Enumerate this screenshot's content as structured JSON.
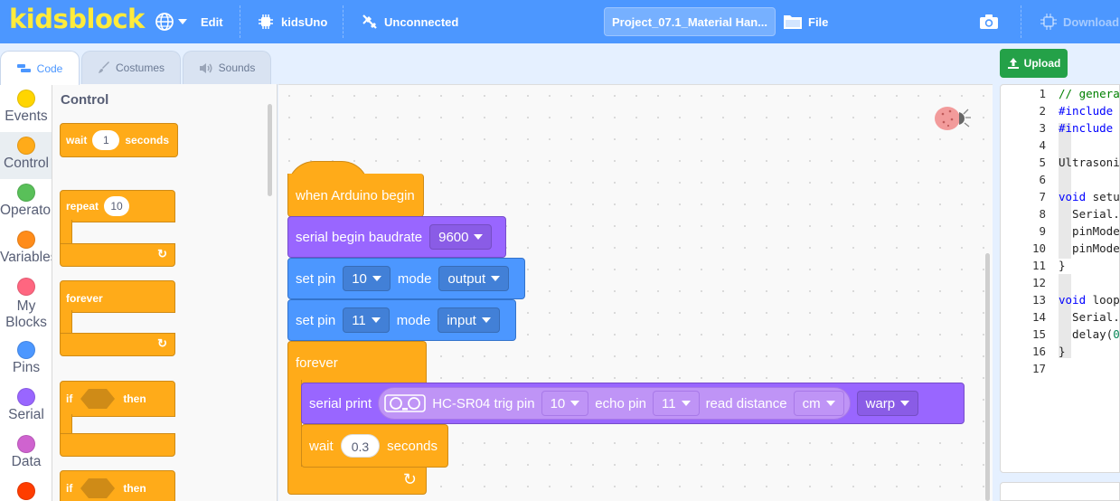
{
  "menubar": {
    "logo": "kidsblock",
    "edit": "Edit",
    "board": "kidsUno",
    "connection": "Unconnected",
    "project_name": "Project_07.1_Material Han...",
    "file": "File",
    "download": "Download"
  },
  "tabs": {
    "code": "Code",
    "costumes": "Costumes",
    "sounds": "Sounds"
  },
  "upload_label": "Upload",
  "categories": [
    {
      "label": "Events",
      "color": "#ffd500"
    },
    {
      "label": "Control",
      "color": "#ffab19"
    },
    {
      "label": "Operators",
      "color": "#59c059"
    },
    {
      "label": "Variables",
      "color": "#ff8c1a"
    },
    {
      "label": "My Blocks",
      "color": "#ff6680"
    },
    {
      "label": "Pins",
      "color": "#4c97ff"
    },
    {
      "label": "Serial",
      "color": "#9966ff"
    },
    {
      "label": "Data",
      "color": "#cf63cf"
    },
    {
      "label": "",
      "color": "#ff3d00"
    }
  ],
  "flyout": {
    "title": "Control",
    "wait": {
      "label": "wait",
      "value": "1",
      "unit": "seconds"
    },
    "repeat": {
      "label": "repeat",
      "value": "10"
    },
    "forever": "forever",
    "if1": {
      "label": "if",
      "then": "then"
    },
    "if2": {
      "label": "if",
      "then": "then"
    }
  },
  "script": {
    "hat": "when Arduino begin",
    "baud": {
      "label": "serial begin baudrate",
      "value": "9600"
    },
    "pin1": {
      "label": "set pin",
      "pin": "10",
      "mode_label": "mode",
      "mode": "output"
    },
    "pin2": {
      "label": "set pin",
      "pin": "11",
      "mode_label": "mode",
      "mode": "input"
    },
    "forever": "forever",
    "print": {
      "label": "serial print",
      "sensor": "HC-SR04 trig pin",
      "trig": "10",
      "echo_label": "echo pin",
      "echo": "11",
      "read_label": "read distance",
      "unit": "cm",
      "newline": "warp"
    },
    "wait": {
      "label": "wait",
      "value": "0.3",
      "unit": "seconds"
    }
  },
  "code": {
    "lines": [
      {
        "n": "1",
        "text": "// genera",
        "cls": "cm"
      },
      {
        "n": "2",
        "text": "#include",
        "cls": "kw"
      },
      {
        "n": "3",
        "text": "#include",
        "cls": "kw"
      },
      {
        "n": "4",
        "text": "",
        "cls": ""
      },
      {
        "n": "5",
        "text": "Ultrasoni",
        "cls": ""
      },
      {
        "n": "6",
        "text": "",
        "cls": ""
      },
      {
        "n": "7",
        "text": "void setu",
        "cls": "kwv"
      },
      {
        "n": "8",
        "text": "  Serial.",
        "cls": ""
      },
      {
        "n": "9",
        "text": "  pinMode",
        "cls": ""
      },
      {
        "n": "10",
        "text": "  pinMode",
        "cls": ""
      },
      {
        "n": "11",
        "text": "}",
        "cls": ""
      },
      {
        "n": "12",
        "text": "",
        "cls": ""
      },
      {
        "n": "13",
        "text": "void loop",
        "cls": "kwv"
      },
      {
        "n": "14",
        "text": "  Serial.",
        "cls": ""
      },
      {
        "n": "15",
        "text": "  delay(0",
        "cls": "delay"
      },
      {
        "n": "16",
        "text": "}",
        "cls": ""
      },
      {
        "n": "17",
        "text": "",
        "cls": ""
      }
    ]
  }
}
